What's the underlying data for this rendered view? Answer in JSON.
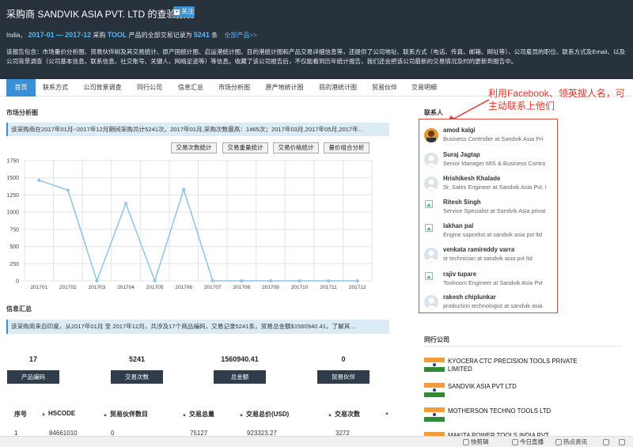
{
  "header": {
    "title": "采购商 SANDVIK ASIA PVT. LTD 的查验报告",
    "follow_label": "关注",
    "country": "India，",
    "period_start": "2017-01",
    "dash": "—",
    "period_end": "2017-12",
    "buy_text": "采购",
    "product": "TOOL",
    "records_text": "产品的全部交易记录为",
    "record_count": "5241",
    "records_unit": "条",
    "all_products_link": "全部产品>>",
    "description": "该报告包含：市场量价分析图、贸易伙伴树及其交易统计、原产国统计图、启运港统计图、目的港统计图和产品交易详细信息等，还提供了公司地址、联系方式（电话、传真、邮箱、网址等）、公司雇员的职位、联系方式及Email、以及公司背景调查（公司基本信息、联系信息、社交账号、关键人、网络足迹等）等信息。收藏了该公司报告后，不仅能看到历年统计报告，我们还会把该公司最新的交易情况及时的更新到报告中。"
  },
  "nav": {
    "tabs": [
      {
        "label": "首页",
        "active": true
      },
      {
        "label": "联系方式"
      },
      {
        "label": "公司背景调查"
      },
      {
        "label": "同行公司"
      },
      {
        "label": "信息汇总"
      },
      {
        "label": "市场分析图"
      },
      {
        "label": "原产地统计图"
      },
      {
        "label": "目的港统计图"
      },
      {
        "label": "贸易伙伴"
      },
      {
        "label": "交易明细"
      }
    ]
  },
  "market": {
    "section_title": "市场分析图",
    "info": "该采购商在2017年01月~2017年12月期间采购共计5241次。2017年01月,采购次数最高：1465次；2017年03月,2017年05月,2017年...",
    "buttons": [
      "交易次数统计",
      "交易重量统计",
      "交易价格统计",
      "量价组合分析"
    ]
  },
  "chart_data": {
    "type": "line",
    "categories": [
      "201701",
      "201702",
      "201703",
      "201704",
      "201705",
      "201706",
      "201707",
      "201708",
      "201709",
      "201710",
      "201711",
      "201712"
    ],
    "series": [
      {
        "values": [
          1465,
          1320,
          0,
          1125,
          0,
          1331,
          0,
          0,
          0,
          0,
          0,
          0
        ]
      }
    ],
    "ylim": [
      0,
      1750
    ],
    "yticks": [
      0,
      250,
      500,
      750,
      1000,
      1250,
      1500,
      1750
    ],
    "grid": true,
    "line_color": "#8ec3e6"
  },
  "summary": {
    "section_title": "信息汇总",
    "info": "该采购商来自印度，从2017年01月 至 2017年12月，共涉及17个商品编码，交易记录5241条，贸易总金额$1560940.41，了解其...",
    "stats": [
      {
        "value": "17",
        "label": "产品编码"
      },
      {
        "value": "5241",
        "label": "交易次数"
      },
      {
        "value": "1560940.41",
        "label": "总金额"
      },
      {
        "value": "0",
        "label": "贸易伙伴"
      }
    ]
  },
  "table": {
    "headers": [
      "序号",
      "HSCODE",
      "贸易伙伴数目",
      "交易总量",
      "交易总价(USD)",
      "交易次数"
    ],
    "rows": [
      [
        "1",
        "84661010",
        "0",
        "75127",
        "923323.27",
        "3272"
      ]
    ]
  },
  "contacts": {
    "title": "联系人",
    "items": [
      {
        "name": "amod kalgi",
        "title": "Business Controller at Sandvik Asia Pri",
        "avatar": "photo"
      },
      {
        "name": "Suraj Jagtap",
        "title": "Senior Manager MIS & Business Contro",
        "avatar": "default"
      },
      {
        "name": "Hrishikesh Khalade",
        "title": "Sr. Sales Engineer at Sandvik Asia Pvt. l",
        "avatar": "default"
      },
      {
        "name": "Ritesh Singh",
        "title": "Service Specialist at Sandvik Asia privat",
        "avatar": "broken"
      },
      {
        "name": "lakhan pal",
        "title": "Engine sapcelist at sandvik asia pvt ltd",
        "avatar": "broken"
      },
      {
        "name": "venkata ramireddy varra",
        "title": "sr technician at sandvik asia pvt ltd",
        "avatar": "default"
      },
      {
        "name": "rajiv tupare",
        "title": "Toolroom Engineer at Sandvik Asia Pvt",
        "avatar": "broken"
      },
      {
        "name": "rakesh chiplunkar",
        "title": "production technologist at sandvik asia",
        "avatar": "default"
      }
    ]
  },
  "annotation": "利用Facebook、领英搜人名，可主动联系上他们",
  "peers": {
    "title": "同行公司",
    "items": [
      "KYOCERA CTC PRECISION TOOLS PRIVATE LIMITED",
      "SANDVIK ASIA PVT LTD",
      "MOTHERSON TECHNO TOOLS LTD",
      "MAKITA POWER TOOLS INDIA PVT"
    ]
  },
  "bottombar": {
    "items": [
      "快剪辑",
      "今日直播",
      "热点资讯"
    ]
  }
}
